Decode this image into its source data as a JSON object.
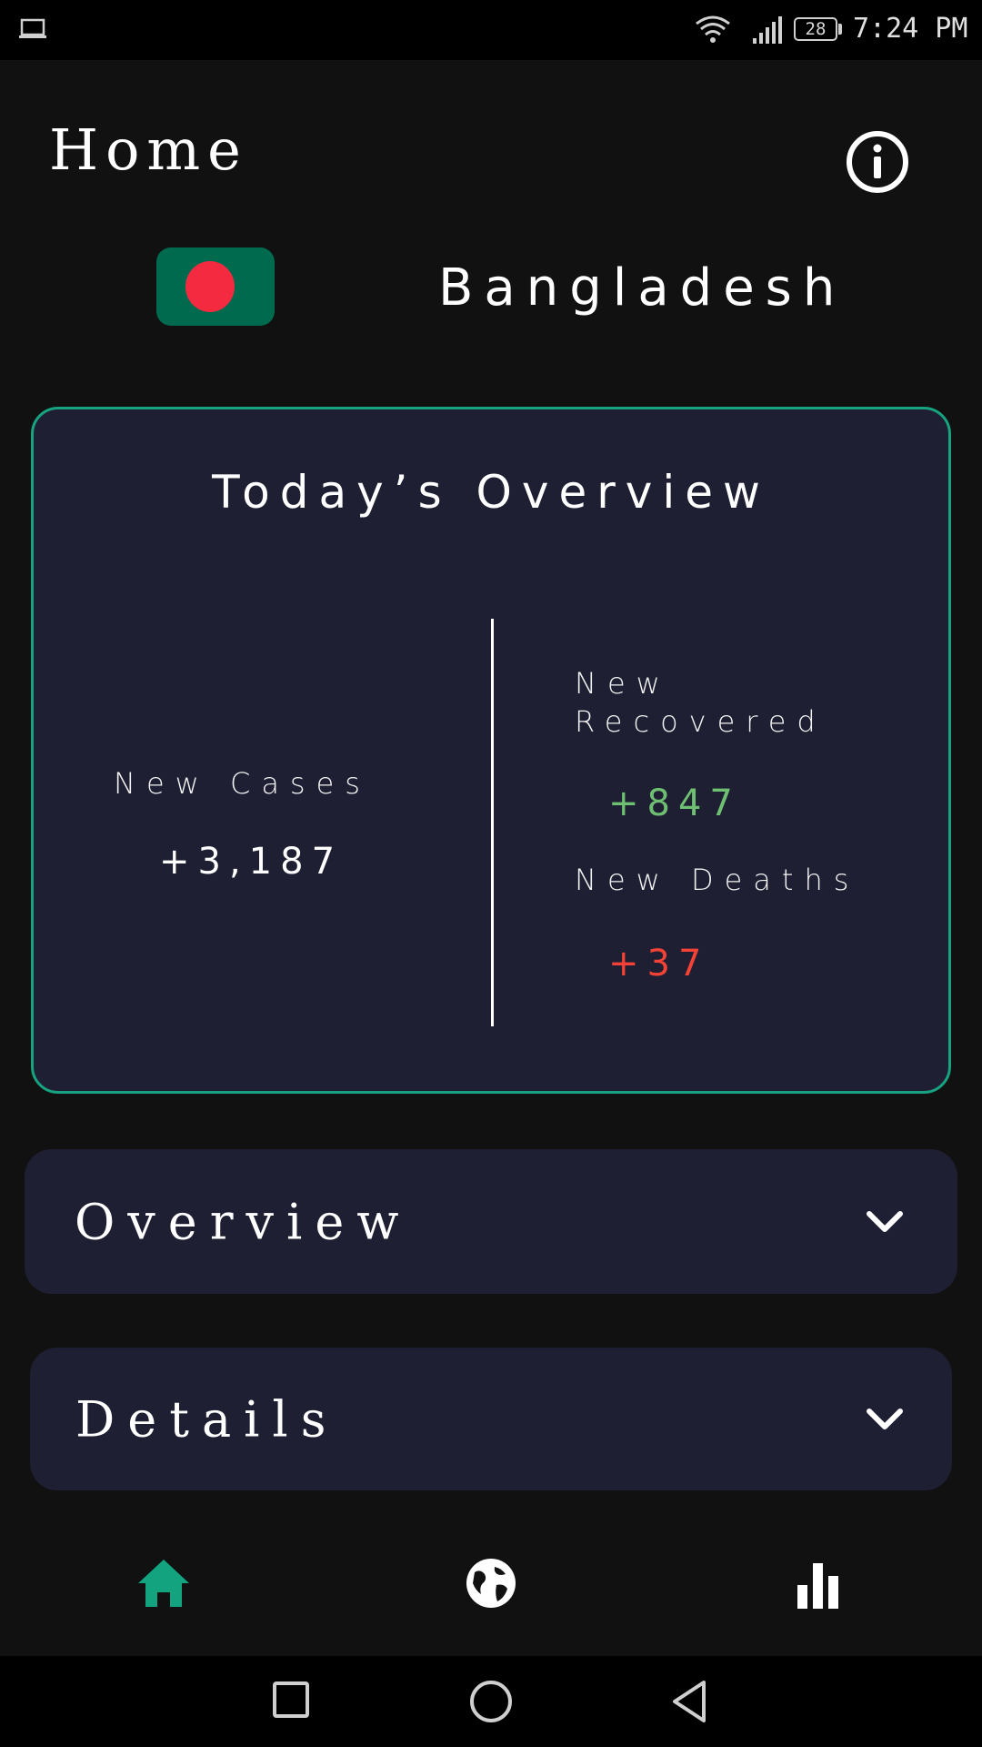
{
  "status_bar": {
    "battery": "28",
    "time": "7:24 PM",
    "icons": [
      "laptop-icon",
      "wifi-icon",
      "signal-icon",
      "battery-icon"
    ]
  },
  "header": {
    "title": "Home",
    "info_icon": "info-icon"
  },
  "country": {
    "name": "Bangladesh",
    "flag_colors": {
      "field": "#006a4e",
      "disc": "#f42a41"
    }
  },
  "today_overview": {
    "title": "Today’s Overview",
    "new_cases_label": "New Cases",
    "new_cases_value": "+3,187",
    "new_recovered_label_line1": "New",
    "new_recovered_label_line2": "Recovered",
    "new_recovered_value": "+847",
    "new_deaths_label": "New Deaths",
    "new_deaths_value": "+37",
    "colors": {
      "border": "#17a37f",
      "recovered": "#6fbf73",
      "deaths": "#f44336",
      "card": "#1e1f33"
    }
  },
  "sections": [
    {
      "label": "Overview",
      "icon": "chevron-down-icon"
    },
    {
      "label": "Details",
      "icon": "chevron-down-icon"
    }
  ],
  "bottom_nav": {
    "items": [
      {
        "icon": "home-icon",
        "active": true
      },
      {
        "icon": "globe-icon",
        "active": false
      },
      {
        "icon": "bar-chart-icon",
        "active": false
      }
    ],
    "active_color": "#14a37f"
  },
  "system_nav": [
    "recent-apps-icon",
    "home-circle-icon",
    "back-icon"
  ]
}
